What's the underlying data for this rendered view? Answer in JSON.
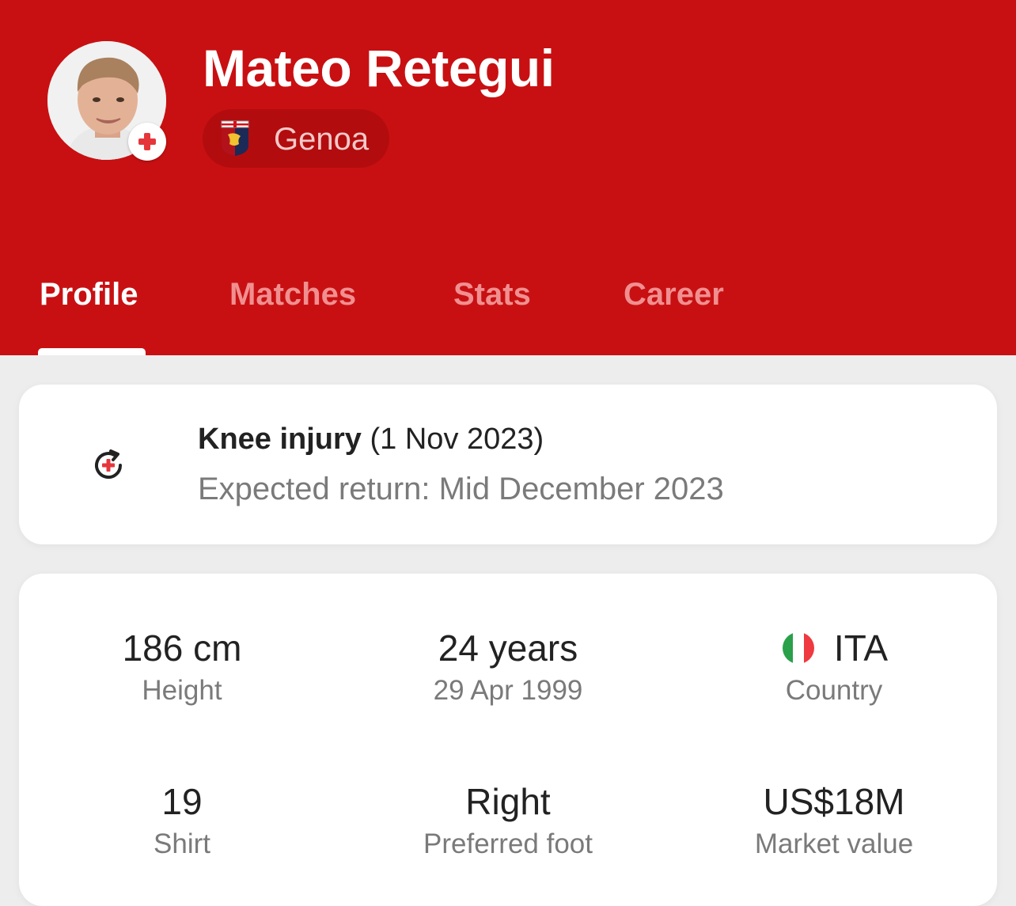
{
  "player": {
    "name": "Mateo Retegui",
    "team": "Genoa"
  },
  "tabs": [
    "Profile",
    "Matches",
    "Stats",
    "Career"
  ],
  "active_tab": "Profile",
  "injury": {
    "title": "Knee injury",
    "date": "(1 Nov 2023)",
    "expected_return": "Expected return: Mid December 2023"
  },
  "stats": {
    "height": {
      "value": "186 cm",
      "label": "Height"
    },
    "age": {
      "value": "24 years",
      "label": "29 Apr 1999"
    },
    "country": {
      "value": "ITA",
      "label": "Country"
    },
    "shirt": {
      "value": "19",
      "label": "Shirt"
    },
    "foot": {
      "value": "Right",
      "label": "Preferred foot"
    },
    "market_value": {
      "value": "US$18M",
      "label": "Market value"
    }
  },
  "colors": {
    "brand_red": "#c81012",
    "chip_red": "#b30c0e",
    "inactive_tab": "#f08f90",
    "injury_cross": "#e5373b",
    "background": "#ededed"
  },
  "icons": {
    "avatar": "player-photo",
    "badge": "injury-cross-icon",
    "crest": "genoa-crest-icon",
    "injury": "injury-return-icon",
    "flag": "italy-flag-icon"
  }
}
